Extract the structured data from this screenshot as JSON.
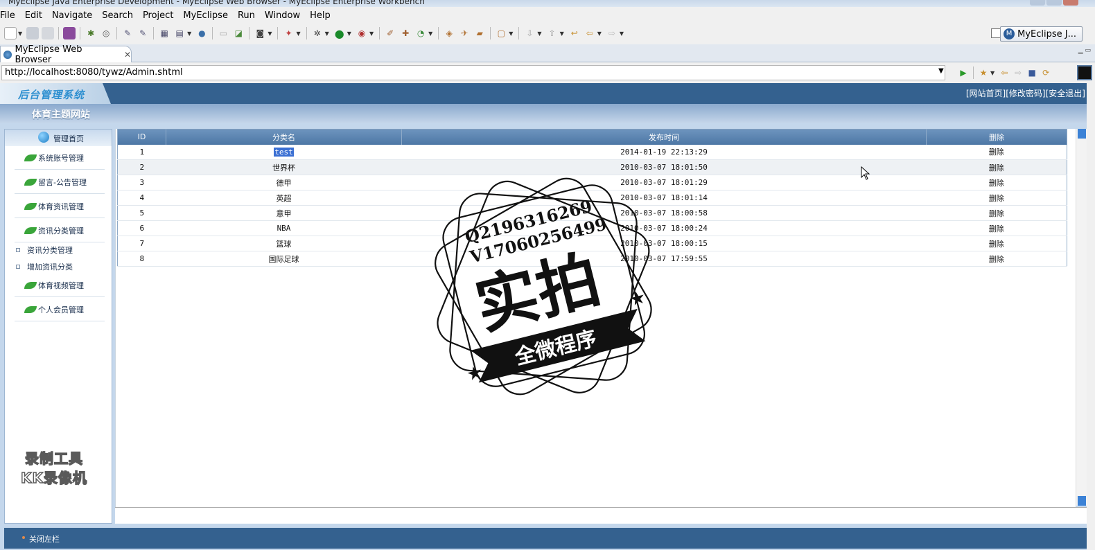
{
  "window": {
    "title": "MyEclipse Java Enterprise Development - MyEclipse Web Browser - MyEclipse Enterprise Workbench"
  },
  "menu": [
    "File",
    "Edit",
    "Navigate",
    "Search",
    "Project",
    "MyEclipse",
    "Run",
    "Window",
    "Help"
  ],
  "perspective": {
    "label": "MyEclipse J..."
  },
  "editor_tab": {
    "label": "MyEclipse Web Browser"
  },
  "browser": {
    "url": "http://localhost:8080/tywz/Admin.shtml"
  },
  "site": {
    "logo": "后台管理系统",
    "subtitle": "体育主题网站",
    "links": [
      "[网站首页]",
      "[修改密码]",
      "[安全退出]"
    ]
  },
  "sidebar": {
    "home": "管理首页",
    "items": [
      {
        "label": "系统账号管理"
      },
      {
        "label": "留言-公告管理"
      },
      {
        "label": "体育资讯管理"
      },
      {
        "label": "资讯分类管理"
      },
      {
        "label": "体育视频管理"
      },
      {
        "label": "个人会员管理"
      }
    ],
    "subitems": [
      "资讯分类管理",
      "增加资讯分类"
    ]
  },
  "table": {
    "headers": [
      "ID",
      "分类名",
      "发布时间",
      "删除"
    ],
    "rows": [
      {
        "id": "1",
        "name": "test",
        "time": "2014-01-19 22:13:29",
        "action": "删除"
      },
      {
        "id": "2",
        "name": "世界杯",
        "time": "2010-03-07 18:01:50",
        "action": "删除"
      },
      {
        "id": "3",
        "name": "德甲",
        "time": "2010-03-07 18:01:29",
        "action": "删除"
      },
      {
        "id": "4",
        "name": "英超",
        "time": "2010-03-07 18:01:14",
        "action": "删除"
      },
      {
        "id": "5",
        "name": "意甲",
        "time": "2010-03-07 18:00:58",
        "action": "删除"
      },
      {
        "id": "6",
        "name": "NBA",
        "time": "2010-03-07 18:00:24",
        "action": "删除"
      },
      {
        "id": "7",
        "name": "篮球",
        "time": "2010-03-07 18:00:15",
        "action": "删除"
      },
      {
        "id": "8",
        "name": "国际足球",
        "time": "2010-03-07 17:59:55",
        "action": "删除"
      }
    ]
  },
  "footer": {
    "label": "关闭左栏"
  },
  "watermarks": {
    "recorder_line1": "录制工具",
    "recorder_line2": "KK录像机",
    "stamp_line1": "Q2196316269",
    "stamp_line2": "V17060256499",
    "stamp_big": "实拍",
    "stamp_banner": "全微程序"
  },
  "colors": {
    "header_bar": "#34618f",
    "table_header": "#5a82ae",
    "sidebar_bg": "#c4d7ec",
    "selection": "#3a6fd3"
  }
}
